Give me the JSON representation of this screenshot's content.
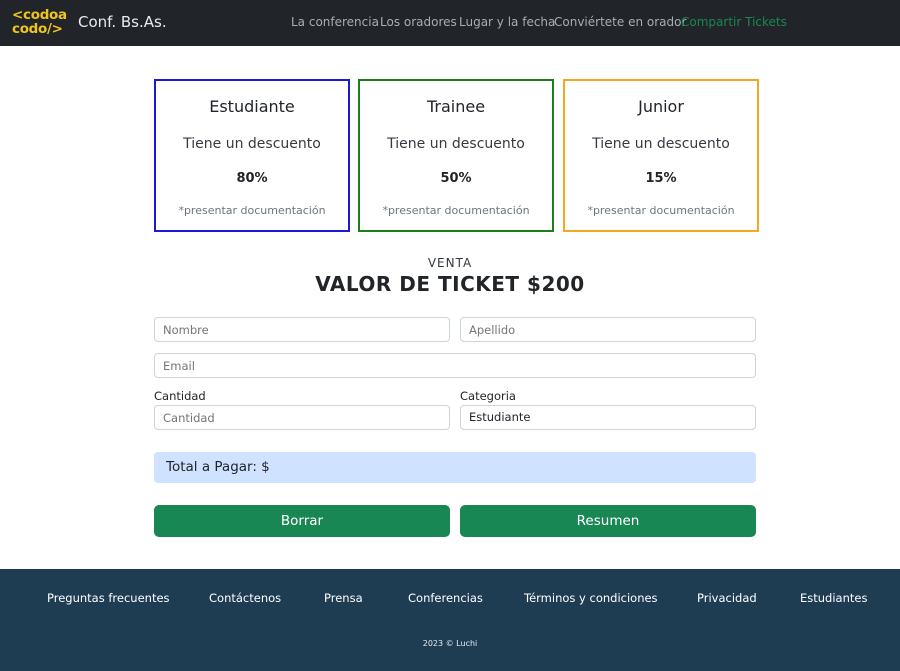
{
  "navbar": {
    "logo_line1": "<codoa",
    "logo_line2": "codo/>",
    "brand": "Conf. Bs.As.",
    "links": [
      {
        "label": "La conferencia"
      },
      {
        "label": "Los oradores"
      },
      {
        "label": "Lugar y la fecha"
      },
      {
        "label": "Conviértete en orador"
      },
      {
        "label": "Compartir Tickets",
        "active": true
      }
    ]
  },
  "cards": [
    {
      "title": "Estudiante",
      "desc": "Tiene un descuento",
      "percent": "80%",
      "note": "*presentar documentación",
      "color": "#1a1ad4"
    },
    {
      "title": "Trainee",
      "desc": "Tiene un descuento",
      "percent": "50%",
      "note": "*presentar documentación",
      "color": "#1a7f1a"
    },
    {
      "title": "Junior",
      "desc": "Tiene un descuento",
      "percent": "15%",
      "note": "*presentar documentación",
      "color": "#f5a623"
    }
  ],
  "venta": {
    "label": "VENTA",
    "title": "VALOR DE TICKET $200"
  },
  "form": {
    "nombre_placeholder": "Nombre",
    "apellido_placeholder": "Apellido",
    "email_placeholder": "Email",
    "cantidad_label": "Cantidad",
    "cantidad_placeholder": "Cantidad",
    "categoria_label": "Categoria",
    "categoria_value": "Estudiante",
    "total_text": "Total a Pagar: $",
    "borrar_label": "Borrar",
    "resumen_label": "Resumen"
  },
  "footer": {
    "links": [
      "Preguntas frecuentes",
      "Contáctenos",
      "Prensa",
      "Conferencias",
      "Términos y condiciones",
      "Privacidad",
      "Estudiantes"
    ],
    "copyright": "2023 © Luchi"
  },
  "colors": {
    "navbar_bg": "#212529",
    "accent_green": "#198754",
    "footer_bg": "#1e3d52",
    "total_bg": "#cfe2ff",
    "logo_yellow": "#f0c420"
  }
}
